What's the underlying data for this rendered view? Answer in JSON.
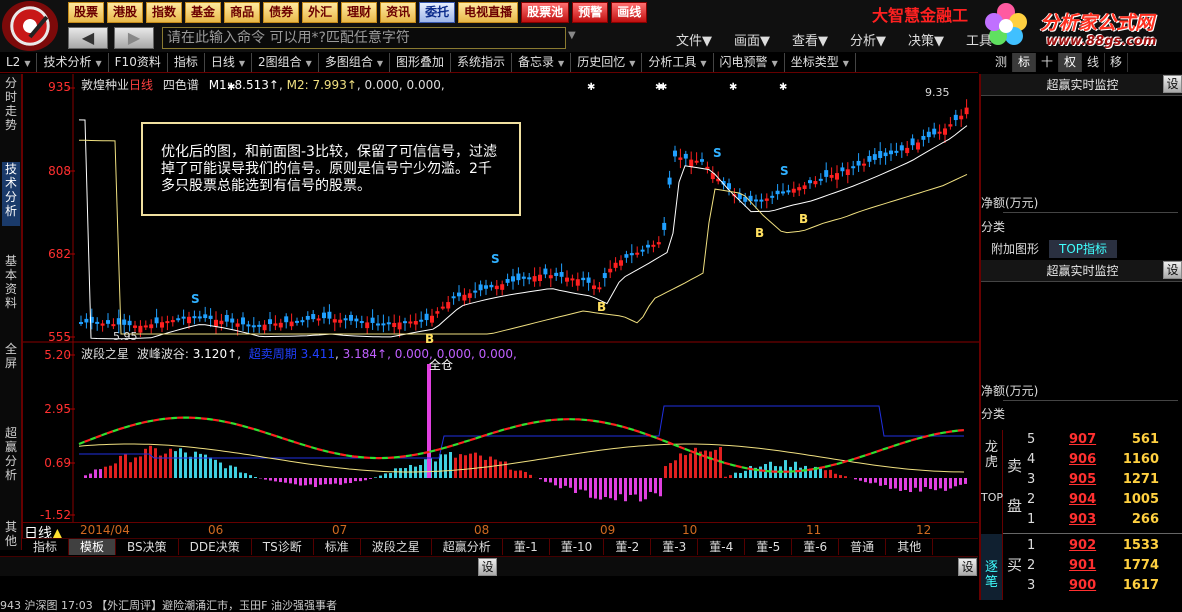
{
  "market_buttons": [
    {
      "label": "股票",
      "style": "gold"
    },
    {
      "label": "港股",
      "style": "gold"
    },
    {
      "label": "指数",
      "style": "gold"
    },
    {
      "label": "基金",
      "style": "gold"
    },
    {
      "label": "商品",
      "style": "gold"
    },
    {
      "label": "债券",
      "style": "gold"
    },
    {
      "label": "外汇",
      "style": "gold"
    },
    {
      "label": "理财",
      "style": "gold"
    },
    {
      "label": "资讯",
      "style": "gold"
    },
    {
      "label": "委托",
      "style": "blue"
    },
    {
      "label": "电视直播",
      "style": "gold"
    },
    {
      "label": "股票池",
      "style": "red"
    },
    {
      "label": "预警",
      "style": "red"
    },
    {
      "label": "画线",
      "style": "red"
    }
  ],
  "brand": {
    "company": "大智慧金融工",
    "title": "分析家公式网",
    "url": "www.88gs.com"
  },
  "command": {
    "placeholder": "请在此输入命令   可以用*?匹配任意字符"
  },
  "menus": [
    "文件▼",
    "画面▼",
    "查看▼",
    "分析▼",
    "决策▼",
    "工具"
  ],
  "toolbar": [
    "L2",
    "技术分析",
    "F10资料",
    "指标",
    "日线",
    "2图组合",
    "多图组合",
    "图形叠加",
    "系统指示",
    "备忘录",
    "历史回忆",
    "分析工具",
    "闪电预警",
    "坐标类型"
  ],
  "right_tabs": [
    {
      "label": "测",
      "on": false
    },
    {
      "label": "标",
      "on": true
    },
    {
      "label": "十",
      "on": false
    },
    {
      "label": "权",
      "on": true
    },
    {
      "label": "线",
      "on": false
    },
    {
      "label": "移",
      "on": false
    }
  ],
  "side_tabs": [
    {
      "label": "分时走势",
      "on": false
    },
    {
      "label": "技术分析",
      "on": true
    },
    {
      "label": "基本资料",
      "on": false
    },
    {
      "label": "全屏",
      "on": false
    },
    {
      "label": "超赢分析",
      "on": false
    },
    {
      "label": "其他",
      "on": false
    }
  ],
  "price_panel": {
    "stock": "敦煌种业",
    "period_tag": "日线",
    "indicator": "四色谱",
    "m1": "M1: 8.513↑",
    "m2": "M2: 7.993↑",
    "zeros": ", 0.000, 0.000,",
    "axis": [
      "935",
      "808",
      "682",
      "555"
    ],
    "top_value": "9.35",
    "low_value": "5.95"
  },
  "indicator_panel": {
    "name": "波段之星",
    "sub": "波峰波谷:",
    "v1": "3.120↑",
    "label2": "超卖周期",
    "v2": "3.411",
    "v3": "3.184↑",
    "zeros": ", 0.000, 0.000, 0.000,",
    "axis": [
      "5.20",
      "2.95",
      "0.69",
      "-1.52"
    ],
    "full_position": "全仓"
  },
  "note": "优化后的图，和前面图-3比较，保留了可信信号，过滤掉了可能误导我们的信号。原则是信号宁少勿滥。2千多只股票总能选到有信号的股票。",
  "signals": {
    "sell": "S",
    "buy": "B"
  },
  "date_axis": {
    "period": "日线",
    "labels": [
      "2014/04",
      "06",
      "07",
      "08",
      "09",
      "10",
      "11",
      "12"
    ]
  },
  "bottom_tabs": [
    {
      "label": "指标",
      "on": false
    },
    {
      "label": "模板",
      "on": true
    },
    {
      "label": "BS决策",
      "on": false
    },
    {
      "label": "DDE决策",
      "on": false
    },
    {
      "label": "TS诊断",
      "on": false
    },
    {
      "label": "标准",
      "on": false
    },
    {
      "label": "波段之星",
      "on": false
    },
    {
      "label": "超赢分析",
      "on": false
    },
    {
      "label": "董-1",
      "on": false
    },
    {
      "label": "董-10",
      "on": false
    },
    {
      "label": "董-2",
      "on": false
    },
    {
      "label": "董-3",
      "on": false
    },
    {
      "label": "董-4",
      "on": false
    },
    {
      "label": "董-5",
      "on": false
    },
    {
      "label": "董-6",
      "on": false
    },
    {
      "label": "普通",
      "on": false
    },
    {
      "label": "其他",
      "on": false
    }
  ],
  "setting_label": "设",
  "right_panel": {
    "monitor_title": "超赢实时监控",
    "net_amount": "净额(万元)",
    "category": "分类",
    "tabs": [
      {
        "label": "附加图形",
        "on": false
      },
      {
        "label": "TOP指标",
        "on": true
      }
    ],
    "monitor_title2": "超赢实时监控",
    "net_amount2": "净额(万元)",
    "category2": "分类",
    "sell_side": "卖 盘",
    "buy_side": "买",
    "dragon_label": "龙虎",
    "top_label": "TOP",
    "flow_label": "逐笔",
    "asks": [
      {
        "level": "5",
        "price": "907",
        "volume": "561"
      },
      {
        "level": "4",
        "price": "906",
        "volume": "1160"
      },
      {
        "level": "3",
        "price": "905",
        "volume": "1271"
      },
      {
        "level": "2",
        "price": "904",
        "volume": "1005"
      },
      {
        "level": "1",
        "price": "903",
        "volume": "266"
      }
    ],
    "bids": [
      {
        "level": "1",
        "price": "902",
        "volume": "1533"
      },
      {
        "level": "2",
        "price": "901",
        "volume": "1774"
      },
      {
        "level": "3",
        "price": "900",
        "volume": "1617"
      }
    ]
  },
  "ticker": "943 沪深图   17:03  【外汇周评】避险潮涌汇市，玉田F  油沙强强事者",
  "colors": {
    "up": "#ff2020",
    "down": "#20a0ff",
    "ma_white": "#ffffff",
    "ma_yellow": "#f0e080",
    "red_panel": "#ff3030"
  }
}
